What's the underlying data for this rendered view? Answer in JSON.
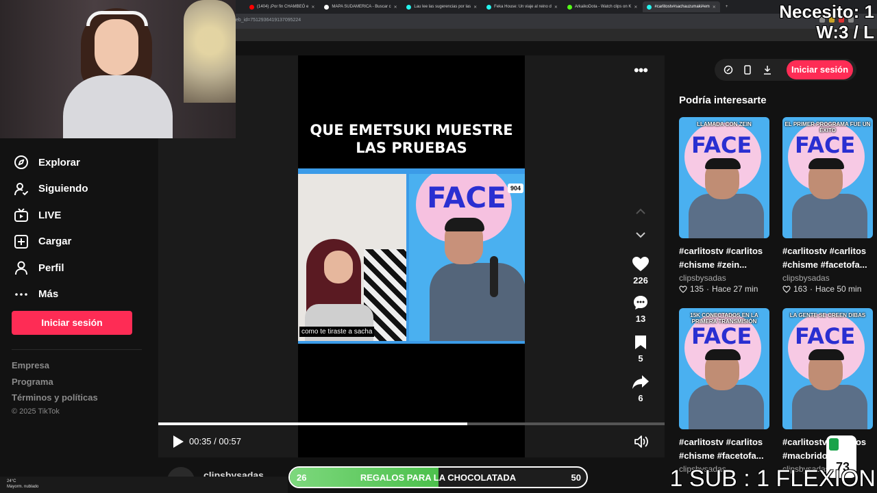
{
  "browser": {
    "tabs": [
      {
        "label": "(1404) ¡Por fin CHAMBEÓ e",
        "favicon_color": "#ff0000",
        "active": false
      },
      {
        "label": "MAPA SUDAMERICA - Buscar c",
        "favicon_color": "#ffffff",
        "active": false
      },
      {
        "label": "Lau lee las sugerencias por las",
        "favicon_color": "#25f4ee",
        "active": false
      },
      {
        "label": "Feka House: Un viaje al reino d",
        "favicon_color": "#25f4ee",
        "active": false
      },
      {
        "label": "ArkaikoDota - Watch clips on K",
        "favicon_color": "#53fc18",
        "active": false
      },
      {
        "label": "#carlitostv#sachauzumaki#em",
        "favicon_color": "#25f4ee",
        "active": true
      }
    ],
    "new_tab": "+",
    "url": "eb_id=7512936419137095224"
  },
  "sidebar": {
    "items": [
      {
        "label": "Explorar",
        "icon": "compass-icon"
      },
      {
        "label": "Siguiendo",
        "icon": "following-icon"
      },
      {
        "label": "LIVE",
        "icon": "live-tv-icon"
      },
      {
        "label": "Cargar",
        "icon": "upload-icon"
      },
      {
        "label": "Perfil",
        "icon": "profile-icon"
      },
      {
        "label": "Más",
        "icon": "more-icon"
      }
    ],
    "login": "Iniciar sesión",
    "footer": [
      "Empresa",
      "Programa",
      "Términos y políticas"
    ],
    "copyright": "© 2025 TikTok"
  },
  "header": {
    "login": "Iniciar sesión"
  },
  "video": {
    "title_line1": "QUE EMETSUKI MUESTRE",
    "title_line2": "LAS PRUEBAS",
    "caption": "como te tiraste a sacha",
    "badge": "904",
    "likes": "226",
    "comments": "13",
    "saves": "5",
    "shares": "6",
    "time_current": "00:35",
    "time_total": "00:57",
    "progress": 0.61,
    "author": "clipsbysadas"
  },
  "recommendations": {
    "title": "Podría interesarte",
    "items": [
      {
        "thumb_caption": "Llamada con Zein",
        "line1": "#carlitostv #carlitos",
        "line2": "#chisme #zein...",
        "author": "clipsbysadas",
        "likes": "135",
        "age": "Hace 27 min"
      },
      {
        "thumb_caption": "El primer programa fue un éxito",
        "line1": "#carlitostv #carlitos",
        "line2": "#chisme #facetofa...",
        "author": "clipsbysadas",
        "likes": "163",
        "age": "Hace 50 min"
      },
      {
        "thumb_caption": "15K conectados en la primera transmisión",
        "line1": "#carlitostv #carlitos",
        "line2": "#chisme #facetofa...",
        "author": "clipsbysadas",
        "likes": "",
        "age": ""
      },
      {
        "thumb_caption": "La gente se creen dibas",
        "line1": "#carlitostv #carlitos",
        "line2": "#macbrido #...",
        "author": "clipsbysadas",
        "likes": "",
        "age": ""
      }
    ]
  },
  "stream_overlay": {
    "counter_line1": "Necesito: 1",
    "counter_line2": "W:3 / L",
    "sub_text": "1 SUB : 1 FLEXION",
    "goal_start": "26",
    "goal_label": "REGALOS PARA LA CHOCOLATADA",
    "goal_end": "50",
    "goal_progress": 0.5,
    "weather_temp": "24°C",
    "weather_desc": "Mayorm. nublado",
    "badge_number": "73"
  },
  "colors": {
    "accent": "#fe2c55",
    "background": "#121212"
  }
}
